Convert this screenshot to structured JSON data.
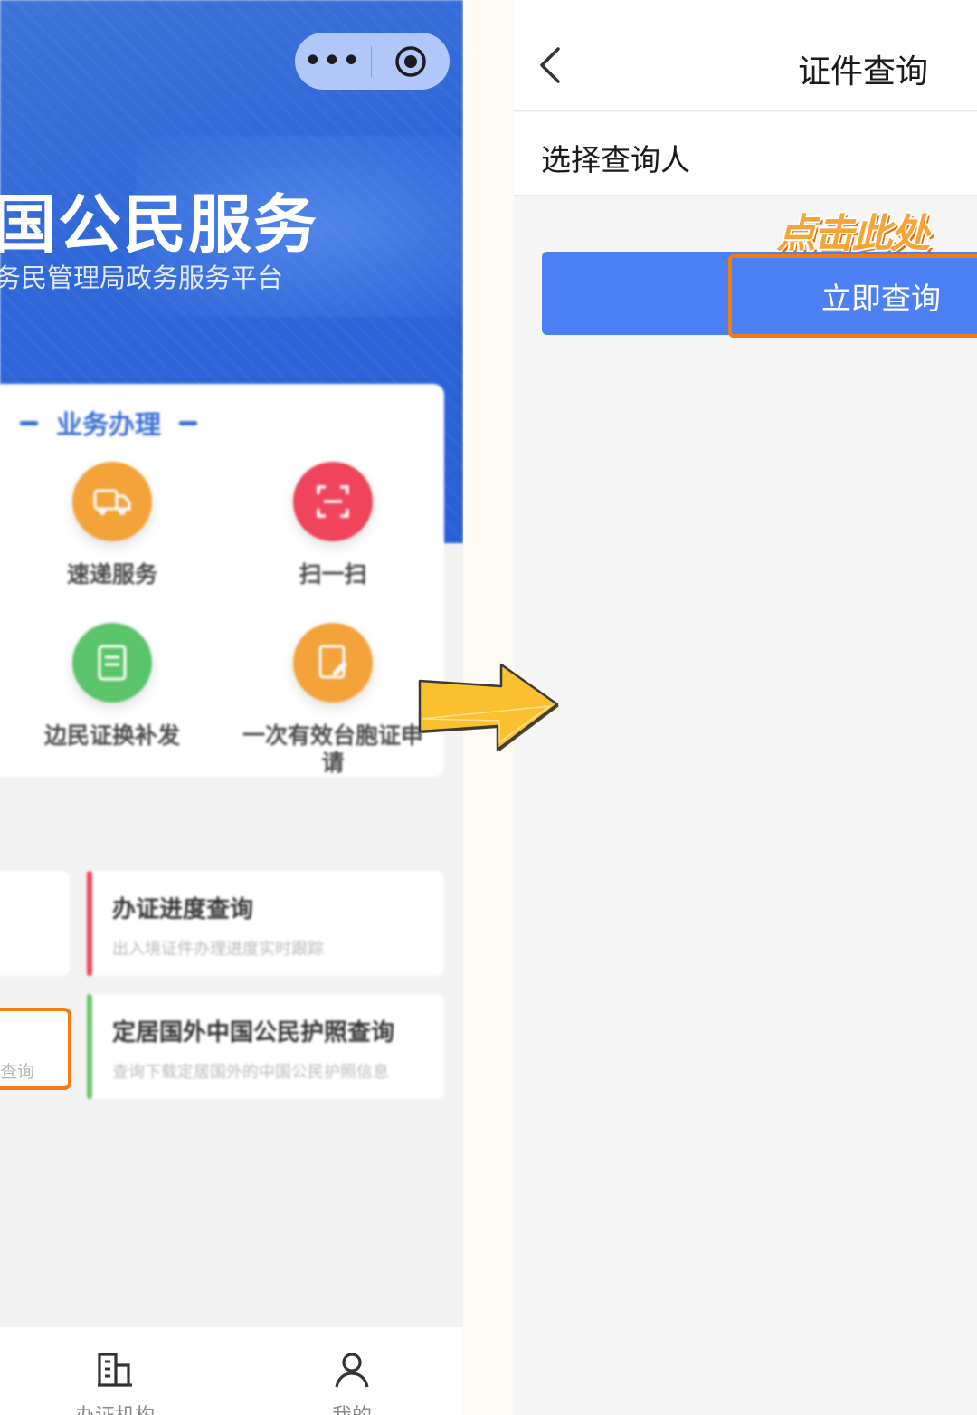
{
  "left_panel": {
    "capsule": {
      "more_label": "•••"
    },
    "hero": {
      "title": "国公民服务",
      "subtitle": "务民管理局政务服务平台"
    },
    "business_section": {
      "heading": "业务办理",
      "services": [
        {
          "label": "速递服务",
          "icon": "truck-icon",
          "color": "#f4a23a"
        },
        {
          "label": "扫一扫",
          "icon": "scan-icon",
          "color": "#f0435c"
        },
        {
          "label": "边民证换补发",
          "icon": "document-icon",
          "color": "#5cc46a"
        },
        {
          "label": "一次有效台胞证申请",
          "icon": "edit-document-icon",
          "color": "#f4a23a"
        }
      ]
    },
    "tiles": [
      {
        "title": "办证进度查询",
        "desc": "出入境证件办理进度实时跟踪",
        "bar_color": "#f0435c"
      },
      {
        "title": "定居国外中国公民护照查询",
        "desc": "查询下载定居国外的中国公民护照信息",
        "bar_color": "#6cc36a"
      }
    ],
    "highlight_tile": {
      "text": "查询"
    },
    "tabbar": [
      {
        "label": "办证机构",
        "icon": "building-icon"
      },
      {
        "label": "我的",
        "icon": "user-icon"
      }
    ]
  },
  "right_panel": {
    "nav": {
      "title": "证件查询",
      "back_icon": "chevron-left-icon"
    },
    "select_person_label": "选择查询人",
    "query_button_label": "立即查询",
    "annotation": "点击此处",
    "colors": {
      "button": "#4d80f5",
      "highlight": "#f37b10"
    }
  },
  "arrow": {
    "icon": "arrow-right-icon",
    "color": "#fbc02d"
  }
}
